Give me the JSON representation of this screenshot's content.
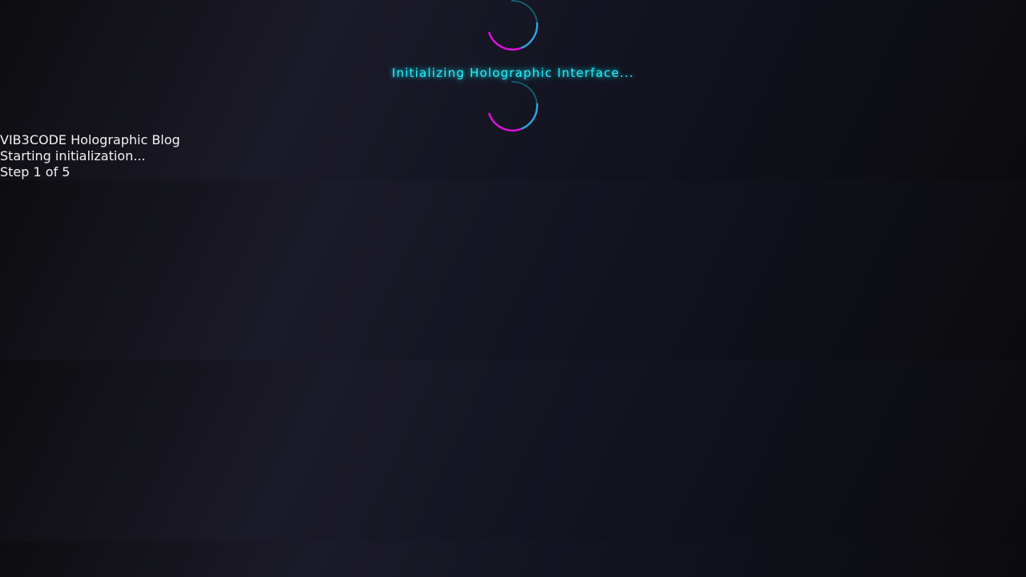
{
  "loader": {
    "message": "Initializing Holographic Interface...",
    "colors": {
      "accent_cyan": "#22f2ff",
      "accent_magenta": "#e010e0",
      "accent_blue": "#2aa8e8"
    }
  },
  "status": {
    "app_name": "VIB3CODE Holographic Blog",
    "step_message": "Starting initialization...",
    "step_progress": "Step 1 of 5"
  }
}
